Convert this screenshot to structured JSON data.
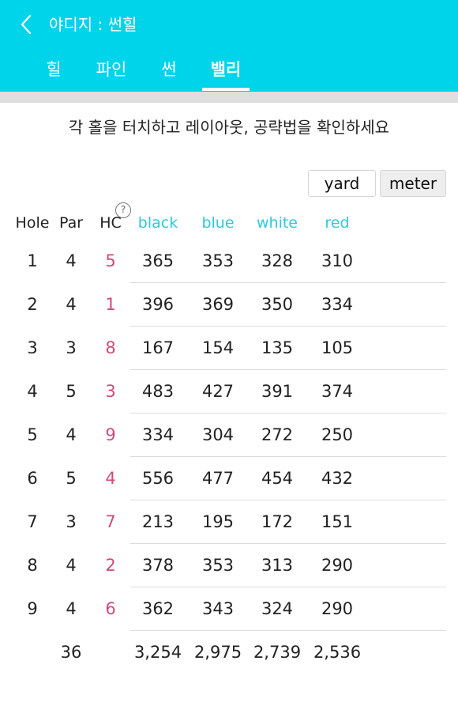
{
  "header": {
    "title": "야디지 : 썬힐",
    "tabs": [
      {
        "label": "힐",
        "active": false
      },
      {
        "label": "파인",
        "active": false
      },
      {
        "label": "썬",
        "active": false
      },
      {
        "label": "밸리",
        "active": true
      }
    ],
    "background_color": "#00d4eb"
  },
  "instruction": "각 홀을 터치하고 레이아웃, 공략법을 확인하세요",
  "units": {
    "yard_label": "yard",
    "meter_label": "meter"
  },
  "table": {
    "headers": {
      "hole": "Hole",
      "par": "Par",
      "hc": "HC",
      "help": "?",
      "black": "black",
      "blue": "blue",
      "white": "white",
      "red": "red"
    },
    "tee_header_color": "#2ec9dc",
    "hc_color": "#d04a7a",
    "rows": [
      {
        "hole": "1",
        "par": "4",
        "hc": "5",
        "black": "365",
        "blue": "353",
        "white": "328",
        "red": "310"
      },
      {
        "hole": "2",
        "par": "4",
        "hc": "1",
        "black": "396",
        "blue": "369",
        "white": "350",
        "red": "334"
      },
      {
        "hole": "3",
        "par": "3",
        "hc": "8",
        "black": "167",
        "blue": "154",
        "white": "135",
        "red": "105"
      },
      {
        "hole": "4",
        "par": "5",
        "hc": "3",
        "black": "483",
        "blue": "427",
        "white": "391",
        "red": "374"
      },
      {
        "hole": "5",
        "par": "4",
        "hc": "9",
        "black": "334",
        "blue": "304",
        "white": "272",
        "red": "250"
      },
      {
        "hole": "6",
        "par": "5",
        "hc": "4",
        "black": "556",
        "blue": "477",
        "white": "454",
        "red": "432"
      },
      {
        "hole": "7",
        "par": "3",
        "hc": "7",
        "black": "213",
        "blue": "195",
        "white": "172",
        "red": "151"
      },
      {
        "hole": "8",
        "par": "4",
        "hc": "2",
        "black": "378",
        "blue": "353",
        "white": "313",
        "red": "290"
      },
      {
        "hole": "9",
        "par": "4",
        "hc": "6",
        "black": "362",
        "blue": "343",
        "white": "324",
        "red": "290"
      }
    ],
    "total": {
      "par": "36",
      "black": "3,254",
      "blue": "2,975",
      "white": "2,739",
      "red": "2,536"
    }
  }
}
